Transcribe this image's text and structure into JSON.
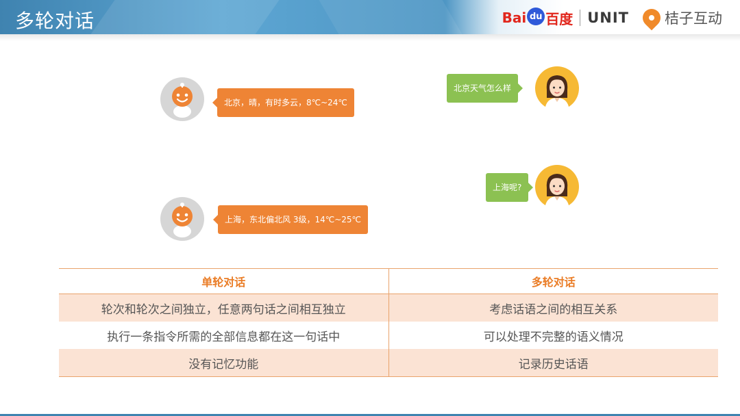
{
  "header": {
    "title": "多轮对话",
    "logos": {
      "baidu_prefix": "Bai",
      "baidu_paw": "du",
      "baidu_suffix": "百度",
      "unit": "UNIT",
      "juzi": "桔子互动"
    }
  },
  "chat": {
    "user_messages": [
      "北京天气怎么样",
      "上海呢?"
    ],
    "bot_replies": [
      "北京，晴，有时多云，8℃~24℃",
      "上海，东北偏北风 3级，14℃~25℃"
    ]
  },
  "comparison": {
    "headers": [
      "单轮对话",
      "多轮对话"
    ],
    "rows": [
      [
        "轮次和轮次之间独立，任意两句话之间相互独立",
        "考虑话语之间的相互关系"
      ],
      [
        "执行一条指令所需的全部信息都在这一句话中",
        "可以处理不完整的语义情况"
      ],
      [
        "没有记忆功能",
        "记录历史话语"
      ]
    ]
  },
  "colors": {
    "accent_orange": "#ee8435",
    "user_green": "#8cc152",
    "header_blue": "#3f83b0",
    "row_shade": "#fbe3d4"
  }
}
